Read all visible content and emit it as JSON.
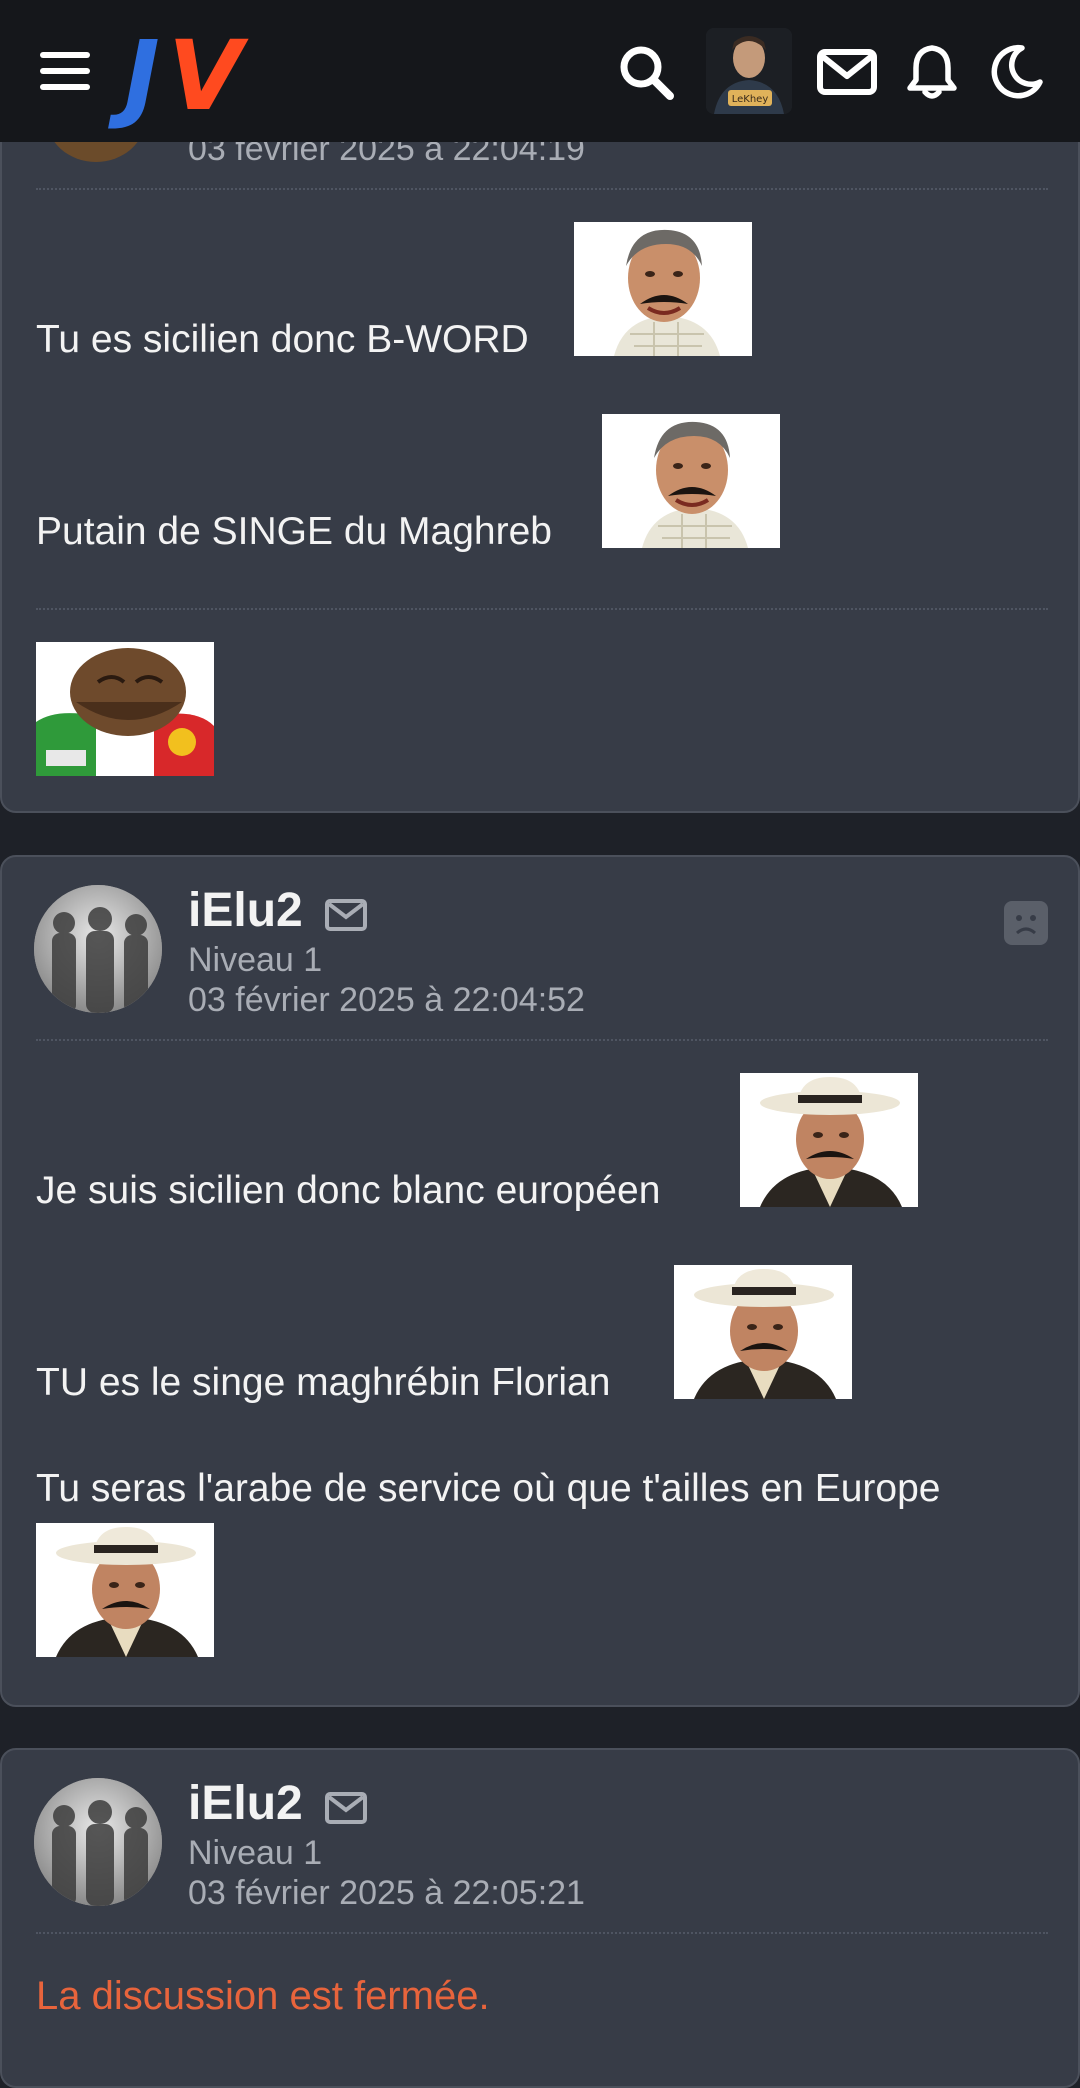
{
  "topbar": {
    "logo_letters": [
      "J",
      "V"
    ],
    "profile_name": "LeKhey",
    "icons": [
      "menu-icon",
      "search-icon",
      "mail-icon",
      "bell-icon",
      "moon-icon"
    ]
  },
  "post1": {
    "date": "03 février 2025 à 22:04:19",
    "lines": [
      "Tu es sicilien donc B-WORD",
      "Putain de SINGE du Maghreb"
    ]
  },
  "post2": {
    "username": "iElu2",
    "level": "Niveau 1",
    "date": "03 février 2025 à 22:04:52",
    "lines": [
      "Je suis sicilien donc blanc européen",
      "TU es le singe maghrébin Florian",
      "Tu seras l'arabe de service où que t'ailles en Europe"
    ]
  },
  "post3": {
    "username": "iElu2",
    "level": "Niveau 1",
    "date": "03 février 2025 à 22:05:21",
    "closed_message": "La discussion est fermée."
  },
  "colors": {
    "background": "#1e2128",
    "card": "#373c47",
    "topbar": "#15171b",
    "logo_j": "#2f6fe0",
    "logo_v": "#ff4a1f",
    "closed": "#e8643c"
  }
}
